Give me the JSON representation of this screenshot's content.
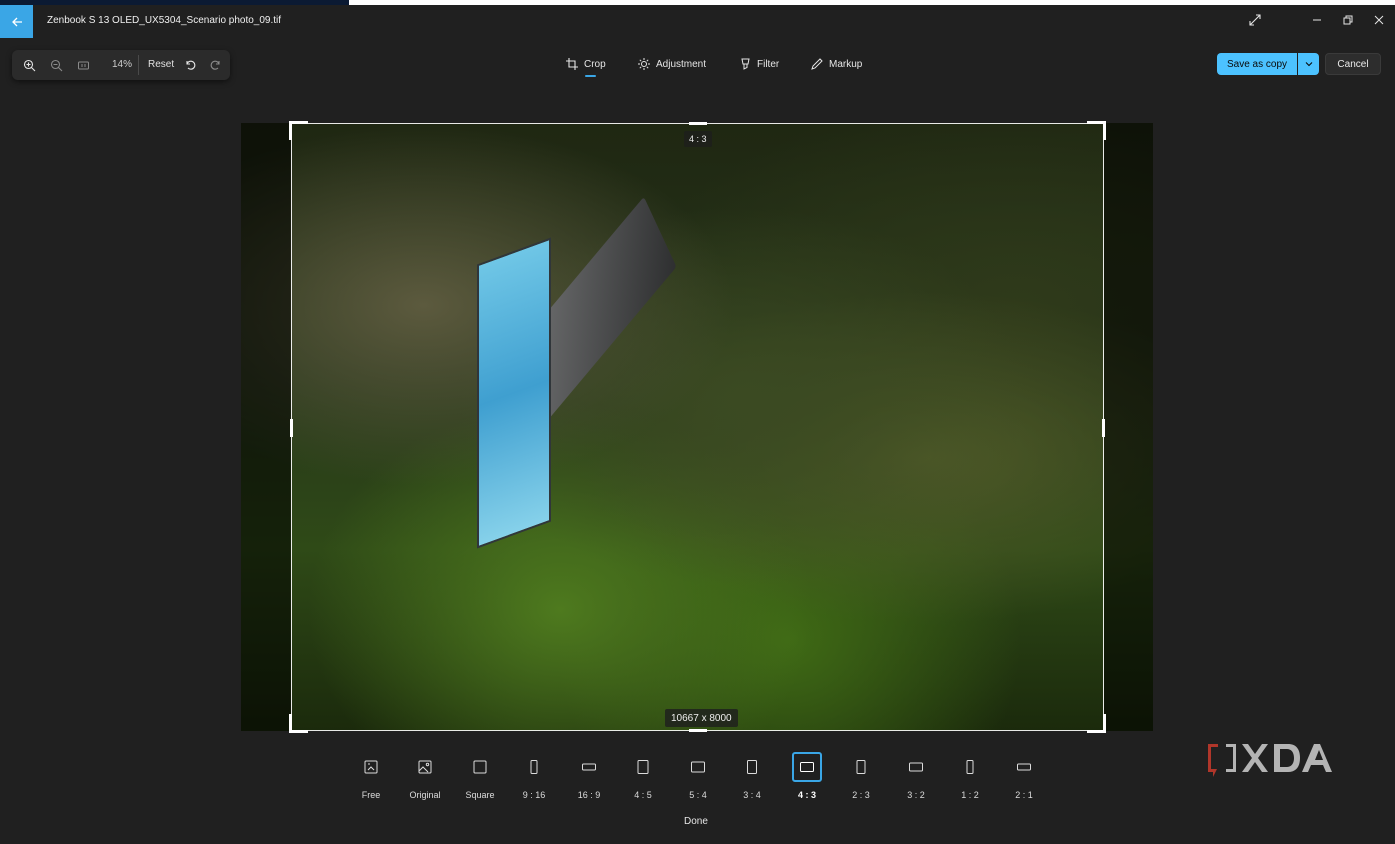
{
  "window": {
    "title": "Zenbook S 13 OLED_UX5304_Scenario photo_09.tif"
  },
  "toolbar": {
    "zoom_value": "14%",
    "reset_label": "Reset",
    "tabs": [
      {
        "label": "Crop",
        "icon": "crop-icon",
        "active": true
      },
      {
        "label": "Adjustment",
        "icon": "brightness-icon",
        "active": false
      },
      {
        "label": "Filter",
        "icon": "filter-icon",
        "active": false
      },
      {
        "label": "Markup",
        "icon": "pen-icon",
        "active": false
      }
    ],
    "save_label": "Save as copy",
    "cancel_label": "Cancel"
  },
  "canvas": {
    "ratio_badge": "4 : 3",
    "size_badge": "10667 x 8000"
  },
  "aspect_ratios": [
    {
      "label": "Free",
      "icon": "free-crop-icon"
    },
    {
      "label": "Original",
      "icon": "image-icon"
    },
    {
      "label": "Square",
      "icon": "square-icon"
    },
    {
      "label": "9 : 16",
      "icon": "portrait-9-16-icon"
    },
    {
      "label": "16 : 9",
      "icon": "landscape-16-9-icon"
    },
    {
      "label": "4 : 5",
      "icon": "portrait-4-5-icon"
    },
    {
      "label": "5 : 4",
      "icon": "landscape-5-4-icon"
    },
    {
      "label": "3 : 4",
      "icon": "portrait-3-4-icon"
    },
    {
      "label": "4 : 3",
      "icon": "landscape-4-3-icon",
      "selected": true
    },
    {
      "label": "2 : 3",
      "icon": "portrait-2-3-icon"
    },
    {
      "label": "3 : 2",
      "icon": "landscape-3-2-icon"
    },
    {
      "label": "1 : 2",
      "icon": "portrait-1-2-icon"
    },
    {
      "label": "2 : 1",
      "icon": "landscape-2-1-icon"
    }
  ],
  "footer": {
    "done_label": "Done"
  },
  "watermark": {
    "text": "XDA"
  },
  "colors": {
    "accent": "#4cc2ff",
    "background": "#202020"
  }
}
